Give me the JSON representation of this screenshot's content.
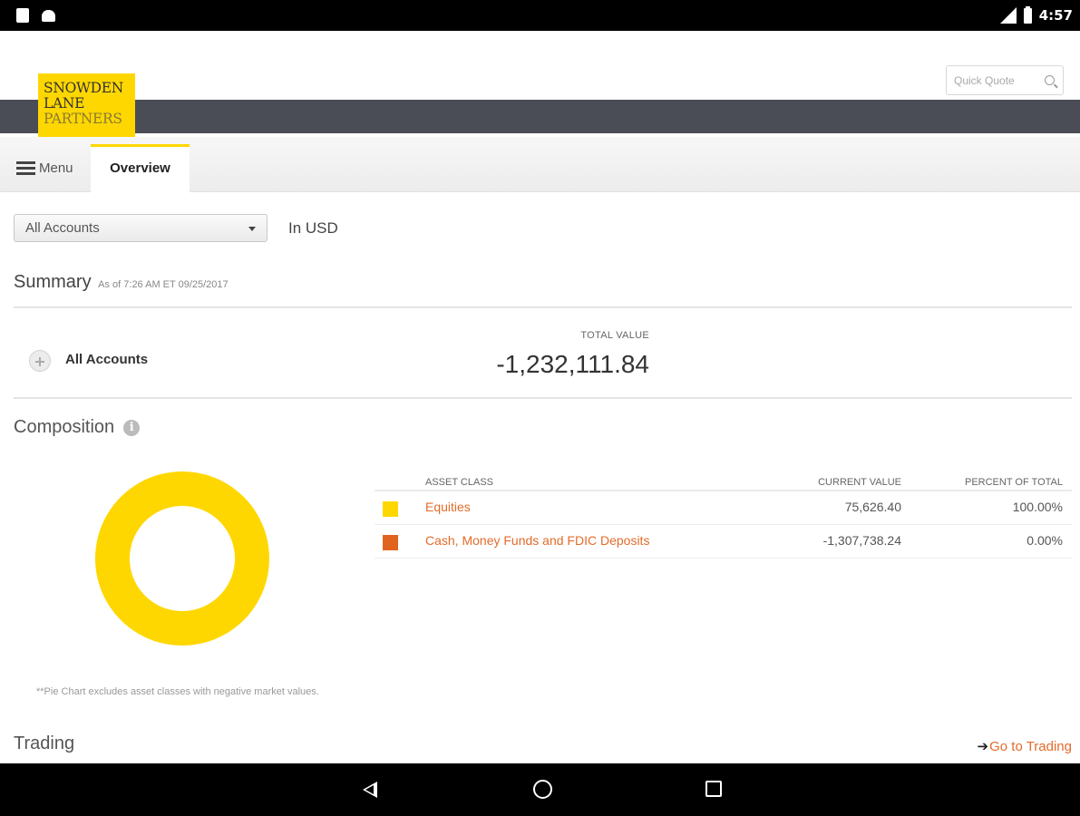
{
  "status_bar": {
    "time": "4:57"
  },
  "brand": {
    "line1": "SNOWDEN",
    "line2": "LANE",
    "line3": "PARTNERS",
    "color": "#ffd700"
  },
  "header": {
    "quick_quote_placeholder": "Quick Quote"
  },
  "tabs": {
    "menu_label": "Menu",
    "active_tab": "Overview"
  },
  "account_filter": {
    "selected": "All Accounts",
    "currency": "In USD"
  },
  "summary": {
    "title": "Summary",
    "as_of": "As of 7:26 AM ET 09/25/2017",
    "account_label": "All Accounts",
    "total_value_label": "TOTAL VALUE",
    "total_value": "-1,232,111.84"
  },
  "composition": {
    "title": "Composition",
    "info_glyph": "i",
    "columns": {
      "asset_class": "ASSET CLASS",
      "current_value": "CURRENT VALUE",
      "percent": "PERCENT OF TOTAL"
    },
    "rows": [
      {
        "name": "Equities",
        "value": "75,626.40",
        "percent": "100.00%",
        "color": "#ffd700"
      },
      {
        "name": "Cash, Money Funds and FDIC Deposits",
        "value": "-1,307,738.24",
        "percent": "0.00%",
        "color": "#e0641f"
      }
    ],
    "pie_note": "**Pie Chart excludes asset classes with negative market values."
  },
  "chart_data": {
    "type": "pie",
    "categories": [
      "Equities"
    ],
    "values": [
      100
    ],
    "colors": [
      "#ffd700"
    ],
    "style": "donut"
  },
  "trading": {
    "title": "Trading",
    "link_label": "Go to Trading",
    "link_arrow": "➔"
  }
}
